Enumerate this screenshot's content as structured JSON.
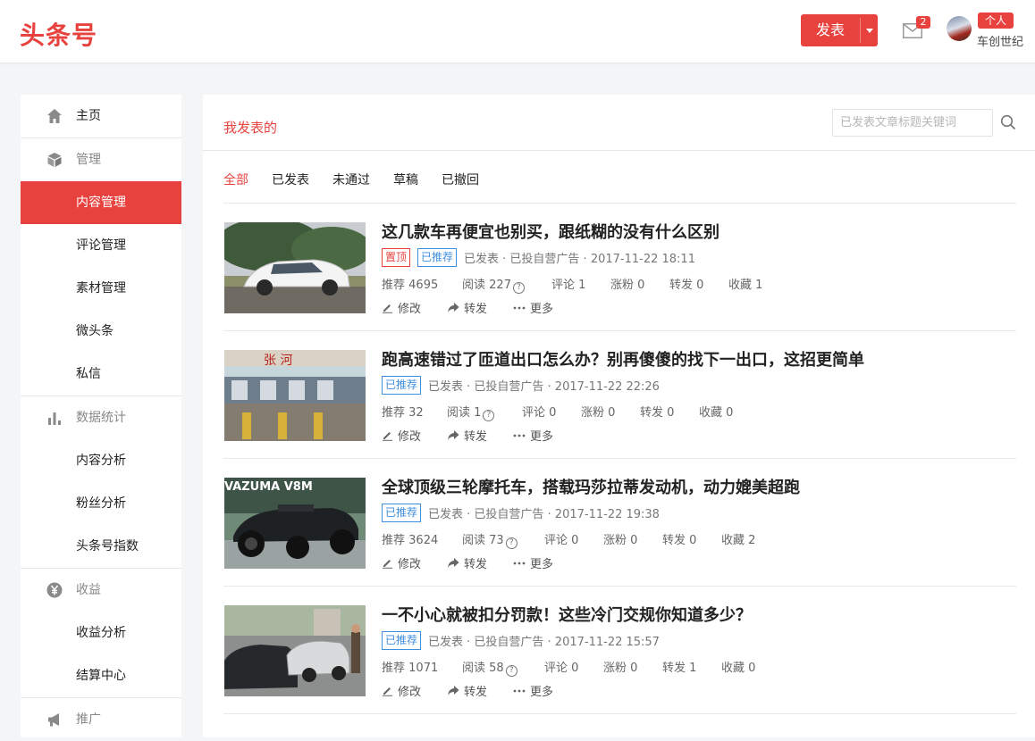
{
  "header": {
    "logo": "头条号",
    "publish_label": "发表",
    "mail_count": "2",
    "account_type": "个人",
    "username": "车创世纪"
  },
  "sidebar": {
    "items": [
      {
        "label": "主页",
        "icon": "home-icon"
      },
      {
        "label": "管理",
        "icon": "cube-icon"
      },
      {
        "label": "内容管理"
      },
      {
        "label": "评论管理"
      },
      {
        "label": "素材管理"
      },
      {
        "label": "微头条"
      },
      {
        "label": "私信"
      },
      {
        "label": "数据统计",
        "icon": "bar-chart-icon"
      },
      {
        "label": "内容分析"
      },
      {
        "label": "粉丝分析"
      },
      {
        "label": "头条号指数"
      },
      {
        "label": "收益",
        "icon": "yen-icon"
      },
      {
        "label": "收益分析"
      },
      {
        "label": "结算中心"
      },
      {
        "label": "推广",
        "icon": "megaphone-icon"
      }
    ]
  },
  "main": {
    "tab": "我发表的",
    "search_placeholder": "已发表文章标题关键词",
    "filters": [
      "全部",
      "已发表",
      "未通过",
      "草稿",
      "已撤回"
    ],
    "stat_labels": {
      "recommend": "推荐",
      "read": "阅读",
      "comment": "评论",
      "fans": "涨粉",
      "forward": "转发",
      "collect": "收藏"
    },
    "actions": {
      "edit": "修改",
      "forward": "转发",
      "more": "更多"
    },
    "articles": [
      {
        "title": "这几款车再便宜也别买，跟纸糊的没有什么区别",
        "tag_top": "置顶",
        "tag_rec": "已推荐",
        "status": "已发表 · 已投自营广告 · 2017-11-22 18:11",
        "recommend": "4695",
        "read": "227",
        "comment": "1",
        "fans": "0",
        "forward": "0",
        "collect": "1"
      },
      {
        "title": "跑高速错过了匝道出口怎么办？别再傻傻的找下一出口，这招更简单",
        "tag_rec": "已推荐",
        "status": "已发表 · 已投自营广告 · 2017-11-22 22:26",
        "recommend": "32",
        "read": "1",
        "comment": "0",
        "fans": "0",
        "forward": "0",
        "collect": "0",
        "thumb_text": "张 河"
      },
      {
        "title": "全球顶级三轮摩托车，搭载玛莎拉蒂发动机，动力媲美超跑",
        "tag_rec": "已推荐",
        "status": "已发表 · 已投自营广告 · 2017-11-22 19:38",
        "recommend": "3624",
        "read": "73",
        "comment": "0",
        "fans": "0",
        "forward": "0",
        "collect": "2",
        "thumb_text": "VAZUMA V8M"
      },
      {
        "title": "一不小心就被扣分罚款！这些冷门交规你知道多少？",
        "tag_rec": "已推荐",
        "status": "已发表 · 已投自营广告 · 2017-11-22 15:57",
        "recommend": "1071",
        "read": "58",
        "comment": "0",
        "fans": "0",
        "forward": "1",
        "collect": "0"
      }
    ]
  },
  "colors": {
    "brand": "#e8423f",
    "recommend_tag": "#3e8ee0"
  }
}
